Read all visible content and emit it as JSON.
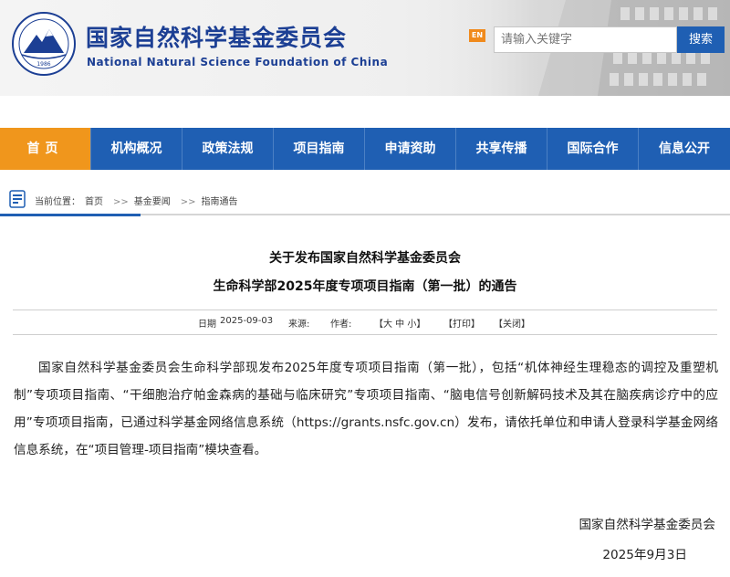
{
  "header": {
    "title_cn": "国家自然科学基金委员会",
    "title_en": "National Natural Science Foundation of China",
    "logo_year": "1986",
    "en_badge": "EN",
    "search_placeholder": "请输入关键字",
    "search_button": "搜索"
  },
  "nav": {
    "items": [
      {
        "label": "首页"
      },
      {
        "label": "机构概况"
      },
      {
        "label": "政策法规"
      },
      {
        "label": "项目指南"
      },
      {
        "label": "申请资助"
      },
      {
        "label": "共享传播"
      },
      {
        "label": "国际合作"
      },
      {
        "label": "信息公开"
      }
    ],
    "active_index": 0
  },
  "breadcrumb": {
    "prefix": "当前位置：",
    "items": [
      "首页",
      "基金要闻",
      "指南通告"
    ],
    "separator": ">>"
  },
  "article": {
    "title_line1": "关于发布国家自然科学基金委员会",
    "title_line2": "生命科学部2025年度专项项目指南（第一批）的通告",
    "meta": {
      "date_label": "日期",
      "date": "2025-09-03",
      "source_label": "来源:",
      "author_label": "作者:",
      "font_size_control": "【大 中 小】",
      "print": "【打印】",
      "close": "【关闭】"
    },
    "body": "国家自然科学基金委员会生命科学部现发布2025年度专项项目指南（第一批），包括“机体神经生理稳态的调控及重塑机制”专项项目指南、“干细胞治疗帕金森病的基础与临床研究”专项项目指南、“脑电信号创新解码技术及其在脑疾病诊疗中的应用”专项项目指南，已通过科学基金网络信息系统（https://grants.nsfc.gov.cn）发布，请依托单位和申请人登录科学基金网络信息系统，在“项目管理-项目指南”模块查看。",
    "signature_org": "国家自然科学基金委员会",
    "signature_date": "2025年9月3日"
  },
  "colors": {
    "brand_blue": "#1f5fb3",
    "active_orange": "#f0961c",
    "title_blue": "#1c3f94"
  }
}
